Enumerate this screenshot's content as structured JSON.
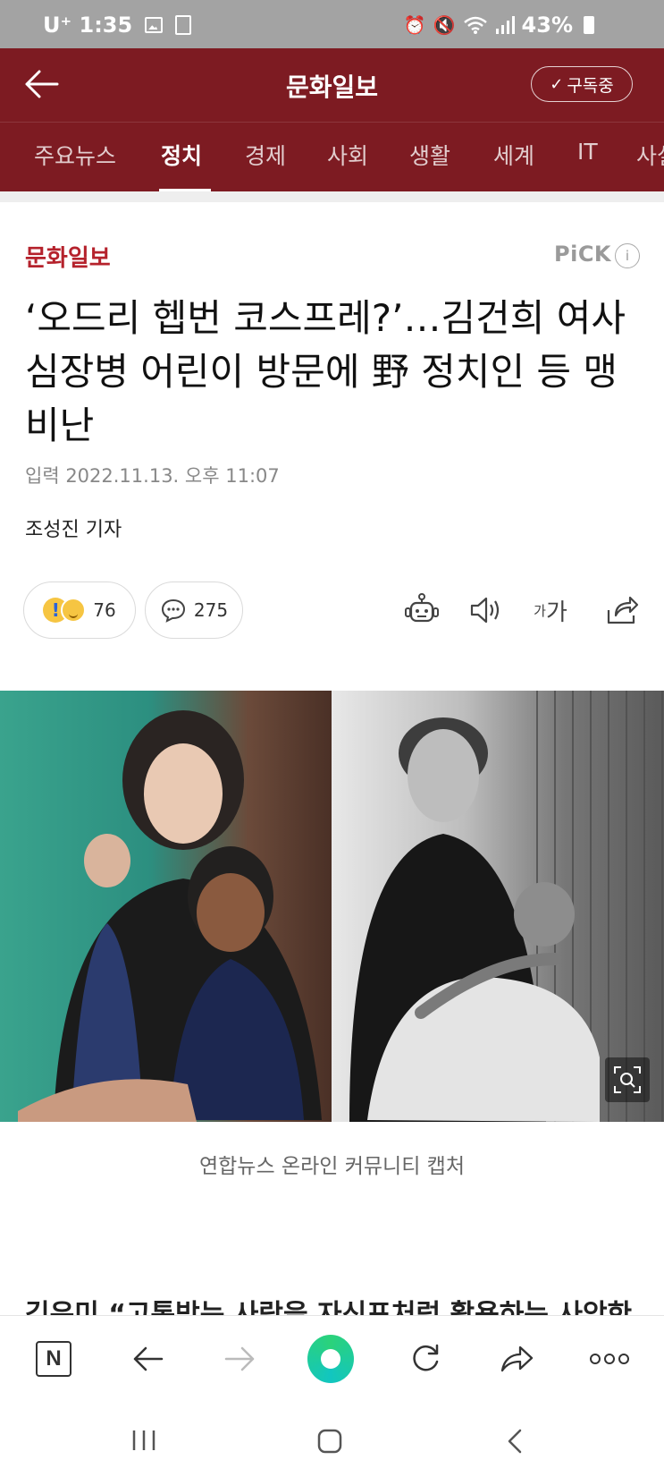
{
  "status_bar": {
    "carrier_time": "U⁺ 1:35",
    "battery": "43%"
  },
  "app_bar": {
    "title": "문화일보",
    "subscribe_label": "구독중"
  },
  "tabs": [
    "주요뉴스",
    "정치",
    "경제",
    "사회",
    "생활",
    "세계",
    "IT",
    "사설"
  ],
  "active_tab": "정치",
  "article": {
    "press": "문화일보",
    "pick_badge": "PiCK",
    "pick_info": "i",
    "headline": "‘오드리 헵번 코스프레?’…김건희 여사 심장병 어린이 방문에 野 정치인 등 맹비난",
    "date": "입력 2022.11.13. 오후 11:07",
    "reporter": "조성진 기자",
    "reaction_emoji": "!",
    "reaction_count": "76",
    "comment_count": "275",
    "font_icon_small": "가",
    "font_icon_large": "가",
    "photo_caption": "연합뉴스 온라인 커뮤니티 캡처",
    "body_peek": "김은미 “고통받는 사람을 자신포처럼 활용하는 사악한"
  },
  "browser_bar": {
    "home_label": "N"
  },
  "icons": {
    "back": "arrow-left-icon",
    "check": "check-icon",
    "robot": "robot-icon",
    "speaker": "speaker-icon",
    "share": "share-icon",
    "zoom": "zoom-icon"
  },
  "colors": {
    "brand": "#7d1b22",
    "press_red": "#b5222c"
  }
}
